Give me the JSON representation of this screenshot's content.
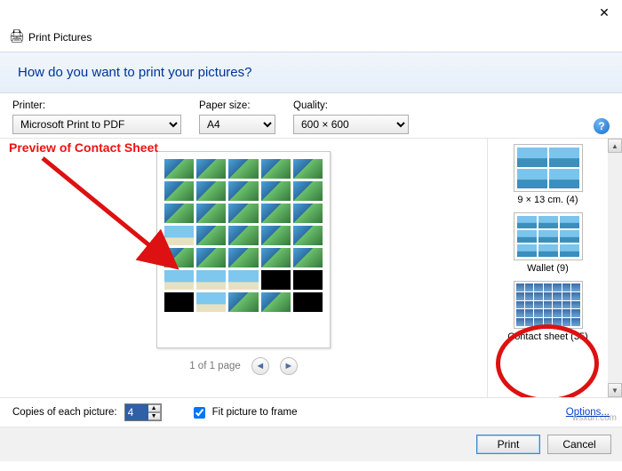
{
  "window": {
    "title": "Print Pictures",
    "prompt": "How do you want to print your pictures?"
  },
  "controls": {
    "printer_label": "Printer:",
    "printer_value": "Microsoft Print to PDF",
    "paper_label": "Paper size:",
    "paper_value": "A4",
    "quality_label": "Quality:",
    "quality_value": "600 × 600"
  },
  "annotation": {
    "text": "Preview of Contact Sheet"
  },
  "pager": {
    "text": "1 of 1 page"
  },
  "layouts": {
    "a": "9 × 13 cm. (4)",
    "b": "Wallet (9)",
    "c": "Contact sheet (35)"
  },
  "footer": {
    "copies_label": "Copies of each picture:",
    "copies_value": "4",
    "fit_label": "Fit picture to frame",
    "options": "Options...",
    "print": "Print",
    "cancel": "Cancel"
  },
  "watermark": "wsxdn.com"
}
